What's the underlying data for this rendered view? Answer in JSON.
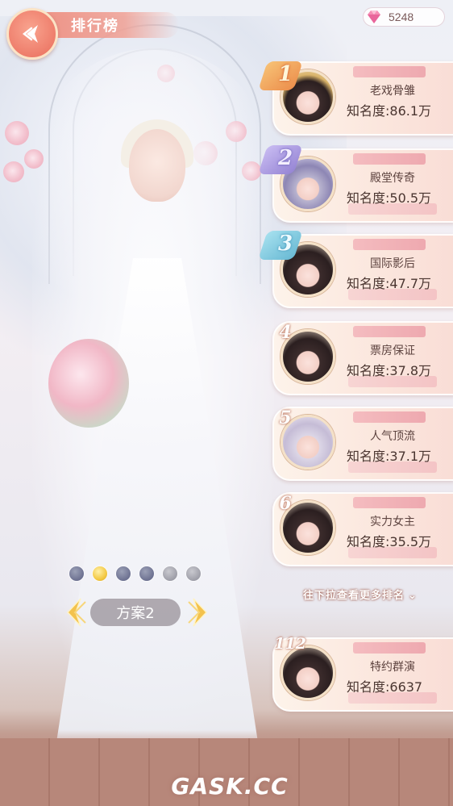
{
  "header": {
    "title": "排行榜",
    "back_icon": "back-arrow-icon"
  },
  "currency": {
    "icon": "diamond-gem-icon",
    "value": "5248"
  },
  "ranking": [
    {
      "rank": "1",
      "title": "老戏骨雏",
      "fame": "知名度:86.1万"
    },
    {
      "rank": "2",
      "title": "殿堂传奇",
      "fame": "知名度:50.5万"
    },
    {
      "rank": "3",
      "title": "国际影后",
      "fame": "知名度:47.7万"
    },
    {
      "rank": "4",
      "title": "票房保证",
      "fame": "知名度:37.8万"
    },
    {
      "rank": "5",
      "title": "人气顶流",
      "fame": "知名度:37.1万"
    },
    {
      "rank": "6",
      "title": "实力女主",
      "fame": "知名度:35.5万"
    }
  ],
  "more_hint": "往下拉查看更多排名",
  "my_rank": {
    "rank": "112",
    "title": "特约群演",
    "fame": "知名度:6637"
  },
  "outfit": {
    "plan_label": "方案2",
    "dots": [
      "default",
      "active",
      "default",
      "default",
      "gray",
      "gray"
    ]
  },
  "watermark": "GASK.CC",
  "colors": {
    "accent": "#ee7d6b",
    "card_bg": "#fbe6dd",
    "text_dark": "#4a3530",
    "active_dot": "#f3c944"
  }
}
